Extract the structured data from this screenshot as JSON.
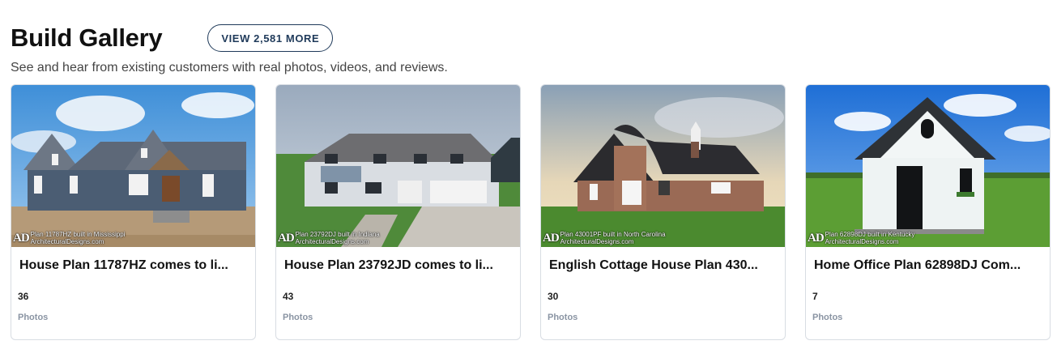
{
  "header": {
    "title": "Build Gallery",
    "view_more_label": "VIEW 2,581 MORE",
    "subtitle": "See and hear from existing customers with real photos, videos, and reviews."
  },
  "cards": [
    {
      "title": "House Plan 11787HZ comes to li...",
      "count": "36",
      "count_label": "Photos",
      "watermark_logo": "AD",
      "watermark_line1": "Plan 11787HZ built in Mississippi",
      "watermark_line2": "ArchitecturalDesigns.com"
    },
    {
      "title": "House Plan 23792JD comes to li...",
      "count": "43",
      "count_label": "Photos",
      "watermark_logo": "AD",
      "watermark_line1": "Plan 23792DJ built in Indiana",
      "watermark_line2": "ArchitecturalDesigns.com"
    },
    {
      "title": "English Cottage House Plan 430...",
      "count": "30",
      "count_label": "Photos",
      "watermark_logo": "AD",
      "watermark_line1": "Plan 43001PF built in North Carolina",
      "watermark_line2": "ArchitecturalDesigns.com"
    },
    {
      "title": "Home Office Plan 62898DJ Com...",
      "count": "7",
      "count_label": "Photos",
      "watermark_logo": "AD",
      "watermark_line1": "Plan 62898DJ built in Kentucky",
      "watermark_line2": "ArchitecturalDesigns.com"
    }
  ],
  "colors": {
    "button_border": "#1f3a5a",
    "card_border": "#d8dde3",
    "muted_label": "#8a94a3"
  }
}
